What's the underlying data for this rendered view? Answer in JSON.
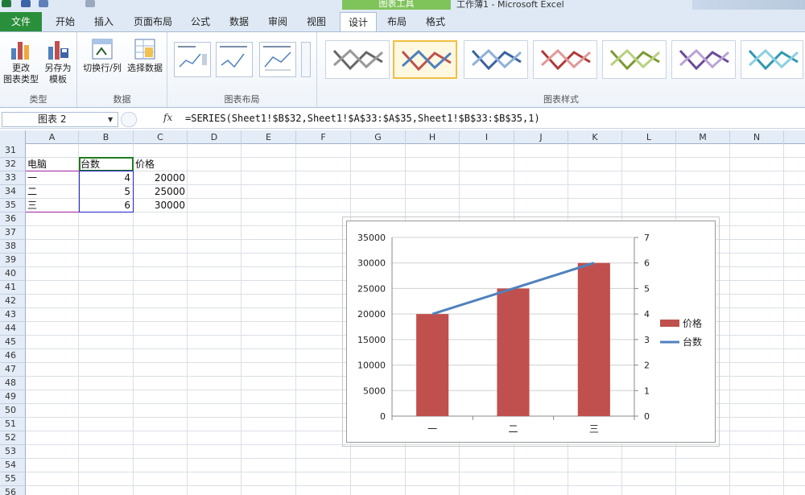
{
  "colors": {
    "ribbon_bg": "#eef3fa",
    "file_tab": "#2a8f3a",
    "context_tab": "#7fc45a",
    "bar": "#c0504d",
    "line": "#4f81bd",
    "selection_green": "#1e7b1e",
    "selection_purple": "#a020a0",
    "selection_blue": "#2222c8"
  },
  "titlebar": {
    "context_header": "图表工具",
    "app_title": "工作薄1 - Microsoft Excel"
  },
  "tabs": [
    {
      "label": "文件",
      "kind": "file"
    },
    {
      "label": "开始"
    },
    {
      "label": "插入"
    },
    {
      "label": "页面布局"
    },
    {
      "label": "公式"
    },
    {
      "label": "数据"
    },
    {
      "label": "审阅"
    },
    {
      "label": "视图"
    },
    {
      "label": "设计",
      "kind": "active"
    },
    {
      "label": "布局"
    },
    {
      "label": "格式"
    }
  ],
  "ribbon": {
    "type_group": {
      "label": "类型",
      "change_type": [
        "更改",
        "图表类型"
      ],
      "save_template": [
        "另存为",
        "模板"
      ]
    },
    "data_group": {
      "label": "数据",
      "switch_row_col": "切换行/列",
      "select_data": "选择数据"
    },
    "layout_group": {
      "label": "图表布局"
    },
    "styles_group": {
      "label": "图表样式"
    },
    "icons": [
      "chart-column-icon",
      "save-template-icon",
      "switch-row-col-icon",
      "select-data-icon"
    ]
  },
  "formula_bar": {
    "name_box": "图表 2",
    "fx_label": "fx",
    "formula": "=SERIES(Sheet1!$B$32,Sheet1!$A$33:$A$35,Sheet1!$B$33:$B$35,1)"
  },
  "sheet": {
    "columns": [
      "A",
      "B",
      "C",
      "D",
      "E",
      "F",
      "G",
      "H",
      "I",
      "J",
      "K",
      "L",
      "M",
      "N"
    ],
    "rows": [
      "31",
      "32",
      "33",
      "34",
      "35",
      "36",
      "37",
      "38",
      "39",
      "40",
      "41",
      "42",
      "43",
      "44",
      "45",
      "46",
      "47",
      "48",
      "49",
      "50",
      "51",
      "52",
      "53",
      "54",
      "55",
      "56"
    ],
    "headers": [
      "电脑",
      "台数",
      "价格"
    ],
    "data": [
      [
        "一",
        "4",
        "20000"
      ],
      [
        "二",
        "5",
        "25000"
      ],
      [
        "三",
        "6",
        "30000"
      ]
    ]
  },
  "chart_data": {
    "type": "bar",
    "categories": [
      "一",
      "二",
      "三"
    ],
    "series": [
      {
        "name": "价格",
        "type": "bar",
        "axis": "left",
        "values": [
          20000,
          25000,
          30000
        ],
        "color": "#c0504d"
      },
      {
        "name": "台数",
        "type": "line",
        "axis": "right",
        "values": [
          4,
          5,
          6
        ],
        "color": "#4f81bd"
      }
    ],
    "ylim": [
      0,
      35000
    ],
    "y_ticks": [
      "0",
      "5000",
      "10000",
      "15000",
      "20000",
      "25000",
      "30000",
      "35000"
    ],
    "y2lim": [
      0,
      7
    ],
    "y2_ticks": [
      "0",
      "1",
      "2",
      "3",
      "4",
      "5",
      "6",
      "7"
    ],
    "grid": true,
    "legend": "right"
  }
}
